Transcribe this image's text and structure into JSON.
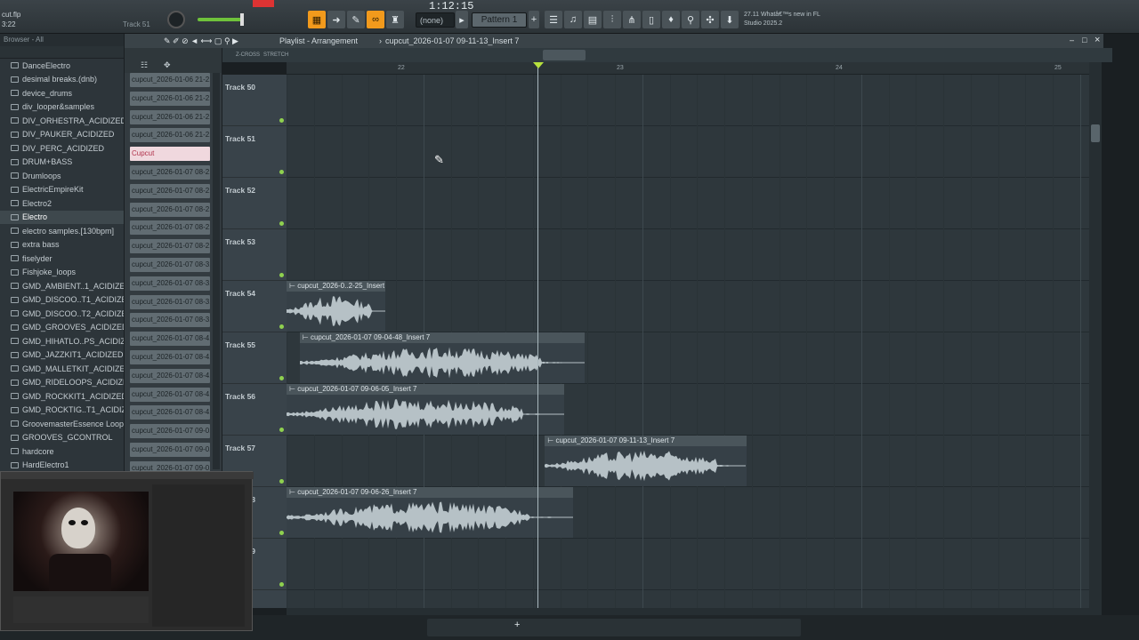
{
  "app": {
    "file_name": "cut.flp",
    "time_small": "3:22",
    "selected_track_hint": "Track 51",
    "time_display": "1:12:15",
    "pattern_none": "(none)",
    "pattern_label": "Pattern 1",
    "news_line1": "27.11  Whatâ€™s new in FL",
    "news_line2": "Studio 2025.2"
  },
  "browser": {
    "header": "Browser - All",
    "items": [
      "DanceElectro",
      "desimal breaks.(dnb)",
      "device_drums",
      "div_looper&samples",
      "DIV_ORHESTRA_ACIDIZED",
      "DIV_PAUKER_ACIDIZED",
      "DIV_PERC_ACIDIZED",
      "DRUM+BASS",
      "Drumloops",
      "ElectricEmpireKit",
      "Electro2",
      "Electro",
      "electro samples.[130bpm]",
      "extra bass",
      "fiselyder",
      "Fishjoke_loops",
      "GMD_AMBIENT..1_ACIDIZED",
      "GMD_DISCOO..T1_ACIDIZED",
      "GMD_DISCOO..T2_ACIDIZED",
      "GMD_GROOVES_ACIDIZED",
      "GMD_HIHATLO..PS_ACIDIZED",
      "GMD_JAZZKIT1_ACIDIZED",
      "GMD_MALLETKIT_ACIDIZED",
      "GMD_RIDELOOPS_ACIDIZED",
      "GMD_ROCKKIT1_ACIDIZED",
      "GMD_ROCKTIG..T1_ACIDIZED",
      "GroovemasterEssence Loops",
      "GROOVES_GCONTROL",
      "hardcore",
      "HardElectro1"
    ],
    "selected": "Electro"
  },
  "picker": {
    "items": [
      "cupcut_2026-01-06 21-2..",
      "cupcut_2026-01-06 21-2..",
      "cupcut_2026-01-06 21-2..",
      "cupcut_2026-01-06 21-2..",
      "Cupcut",
      "cupcut_2026-01-07 08-2..",
      "cupcut_2026-01-07 08-2..",
      "cupcut_2026-01-07 08-2..",
      "cupcut_2026-01-07 08-2..",
      "cupcut_2026-01-07 08-2..",
      "cupcut_2026-01-07 08-3..",
      "cupcut_2026-01-07 08-3..",
      "cupcut_2026-01-07 08-3..",
      "cupcut_2026-01-07 08-3..",
      "cupcut_2026-01-07 08-4..",
      "cupcut_2026-01-07 08-4..",
      "cupcut_2026-01-07 08-4..",
      "cupcut_2026-01-07 08-4..",
      "cupcut_2026-01-07 08-4..",
      "cupcut_2026-01-07 09-0..",
      "cupcut_2026-01-07 09-0..",
      "cupcut_2026-01-07 09-0.."
    ],
    "selected": "Cupcut"
  },
  "playlist": {
    "title": "Playlist - Arrangement",
    "breadcrumb_sep": "›",
    "current_clip": "cupcut_2026-01-07 09-11-13_Insert 7",
    "zcross": "Z-CROSS",
    "stretch": "STRETCH",
    "ruler": [
      "22",
      "23",
      "24",
      "25"
    ],
    "tracks": [
      "Track 50",
      "Track 51",
      "Track 52",
      "Track 53",
      "Track 54",
      "Track 55",
      "Track 56",
      "Track 57",
      "Track 58",
      "Track 59"
    ],
    "clips": [
      {
        "name": "cupcut_2026-0..2-25_Insert 7",
        "track": 4,
        "start": 0.0,
        "len": 0.45
      },
      {
        "name": "cupcut_2026-01-07 09-04-48_Insert 7",
        "track": 5,
        "start": 0.06,
        "len": 1.3
      },
      {
        "name": "cupcut_2026-01-07 09-06-05_Insert 7",
        "track": 6,
        "start": 0.0,
        "len": 1.27
      },
      {
        "name": "cupcut_2026-01-07 09-11-13_Insert 7",
        "track": 7,
        "start": 1.18,
        "len": 0.92
      },
      {
        "name": "cupcut_2026-01-07 09-06-26_Insert 7",
        "track": 8,
        "start": 0.0,
        "len": 1.31
      }
    ]
  },
  "colors": {
    "accent": "#f29a1c",
    "clip_title": "#4a555b",
    "selected_picker": "#f0d8de",
    "led": "#8fd14f"
  }
}
